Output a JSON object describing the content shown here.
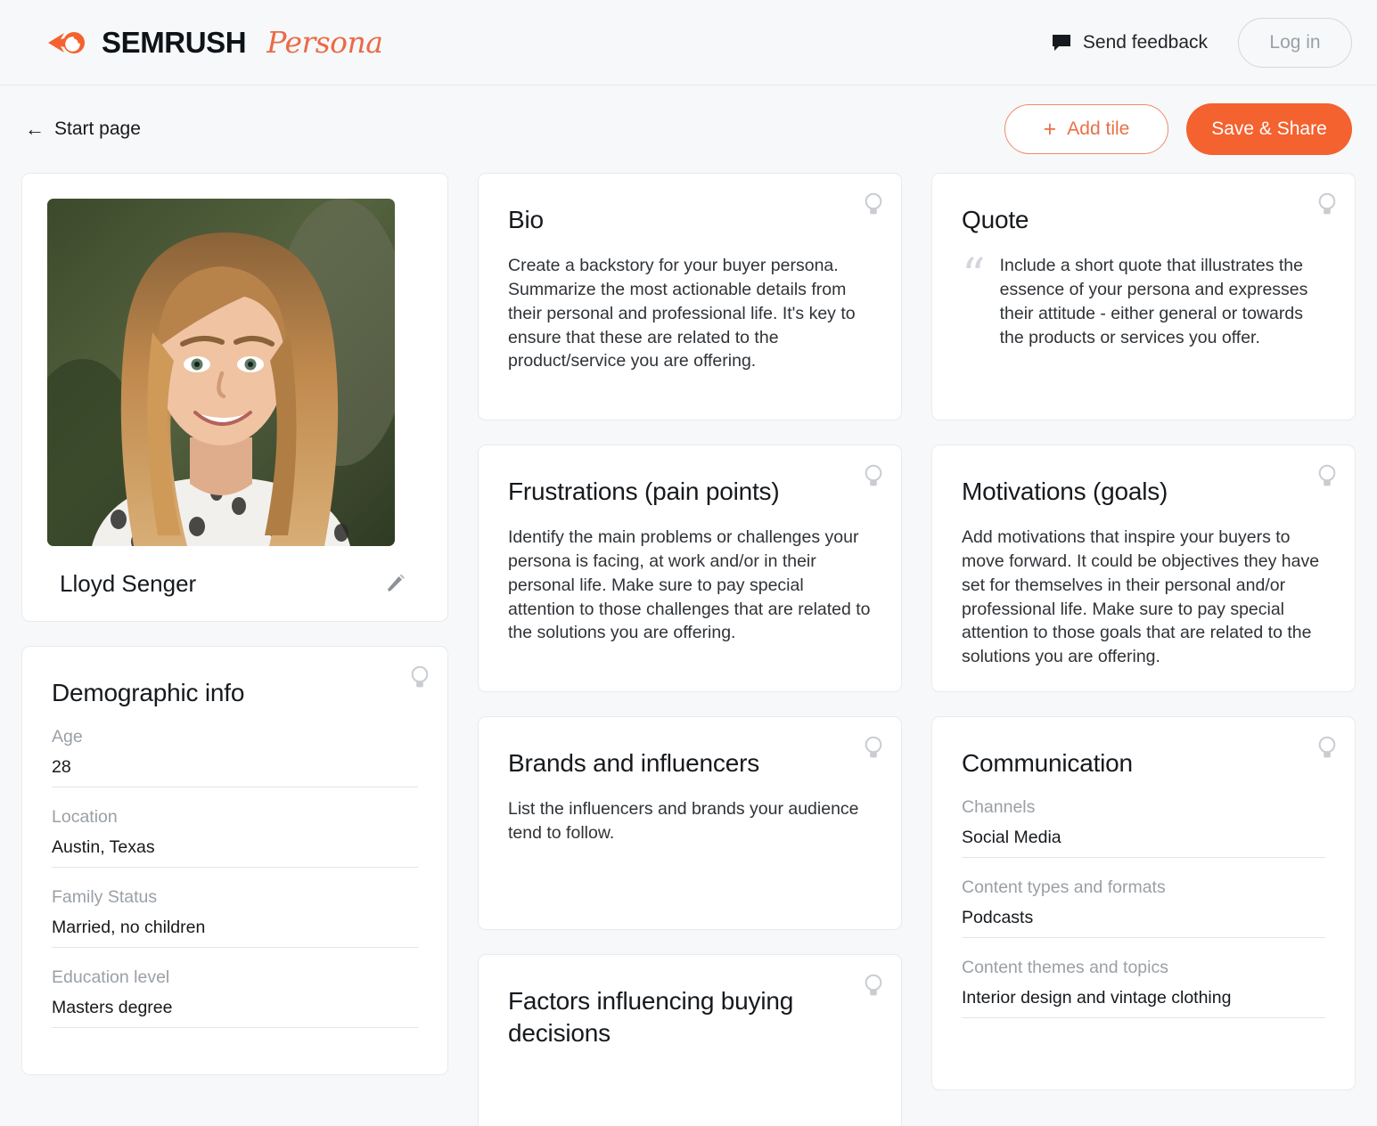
{
  "header": {
    "brand_name": "SEMRUSH",
    "product_name": "Persona",
    "feedback_label": "Send feedback",
    "login_label": "Log in",
    "accent_color": "#f4622f",
    "logo_icon": "semrush-comet-icon",
    "feedback_icon": "speech-bubble-icon"
  },
  "actions": {
    "back_label": "Start page",
    "back_icon": "arrow-left-icon",
    "add_tile_label": "Add tile",
    "add_tile_icon": "plus-icon",
    "save_label": "Save & Share"
  },
  "profile": {
    "name": "Lloyd Senger",
    "edit_icon": "pencil-icon",
    "photo_alt": "persona-portrait"
  },
  "demographic": {
    "title": "Demographic info",
    "hint_icon": "lightbulb-icon",
    "fields": [
      {
        "label": "Age",
        "value": "28"
      },
      {
        "label": "Location",
        "value": "Austin, Texas"
      },
      {
        "label": "Family Status",
        "value": "Married, no children"
      },
      {
        "label": "Education level",
        "value": "Masters degree"
      }
    ]
  },
  "bio": {
    "title": "Bio",
    "hint_icon": "lightbulb-icon",
    "description": "Create a backstory for your buyer persona. Summarize the most actionable details from their personal and professional life. It's key to ensure that these are related to the product/service you are offering."
  },
  "quote": {
    "title": "Quote",
    "hint_icon": "lightbulb-icon",
    "quote_mark": "“",
    "description": "Include a short quote that illustrates the essence of your persona and expresses their attitude - either general or towards the products or services you offer."
  },
  "frustrations": {
    "title": "Frustrations (pain points)",
    "hint_icon": "lightbulb-icon",
    "description": "Identify the main problems or challenges your persona is facing, at work and/or in their personal life. Make sure to pay special attention to those challenges that are related to the solutions you are offering."
  },
  "motivations": {
    "title": "Motivations (goals)",
    "hint_icon": "lightbulb-icon",
    "description": "Add motivations that inspire your buyers to move forward. It could be objectives they have set for themselves in their personal and/or professional life. Make sure to pay special attention to those goals that are related to the solutions you are offering."
  },
  "brands": {
    "title": "Brands and influencers",
    "hint_icon": "lightbulb-icon",
    "description": "List the influencers and brands your audience tend to follow."
  },
  "factors": {
    "title": "Factors influencing buying decisions",
    "hint_icon": "lightbulb-icon"
  },
  "communication": {
    "title": "Communication",
    "hint_icon": "lightbulb-icon",
    "fields": [
      {
        "label": "Channels",
        "value": "Social Media"
      },
      {
        "label": "Content types and formats",
        "value": "Podcasts"
      },
      {
        "label": "Content themes and topics",
        "value": "Interior design and vintage clothing"
      }
    ]
  }
}
